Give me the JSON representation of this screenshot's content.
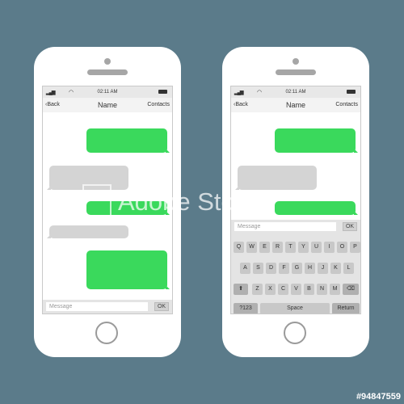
{
  "phones": {
    "left": {
      "status": {
        "time": "02:11 AM"
      },
      "nav": {
        "back": "‹Back",
        "title": "Name",
        "contacts": "Contacts"
      },
      "input": {
        "placeholder": "Message",
        "ok": "OK"
      }
    },
    "right": {
      "status": {
        "time": "02:11 AM"
      },
      "nav": {
        "back": "‹Back",
        "title": "Name",
        "contacts": "Contacts"
      },
      "input": {
        "placeholder": "Message",
        "ok": "OK"
      },
      "keyboard": {
        "row1": [
          "Q",
          "W",
          "E",
          "R",
          "T",
          "Y",
          "U",
          "I",
          "O",
          "P"
        ],
        "row2": [
          "A",
          "S",
          "D",
          "F",
          "G",
          "H",
          "J",
          "K",
          "L"
        ],
        "row3": [
          "Z",
          "X",
          "C",
          "V",
          "B",
          "N",
          "M"
        ],
        "shift": "⬆",
        "backspace": "⌫",
        "numbers": "?123",
        "space": "Space",
        "return": "Return"
      }
    }
  },
  "watermark": {
    "text": "Adobe Stock"
  },
  "stock_id": "#94847559",
  "colors": {
    "background": "#5b7b8a",
    "sent_bubble": "#3ad95c",
    "received_bubble": "#d4d4d4"
  }
}
